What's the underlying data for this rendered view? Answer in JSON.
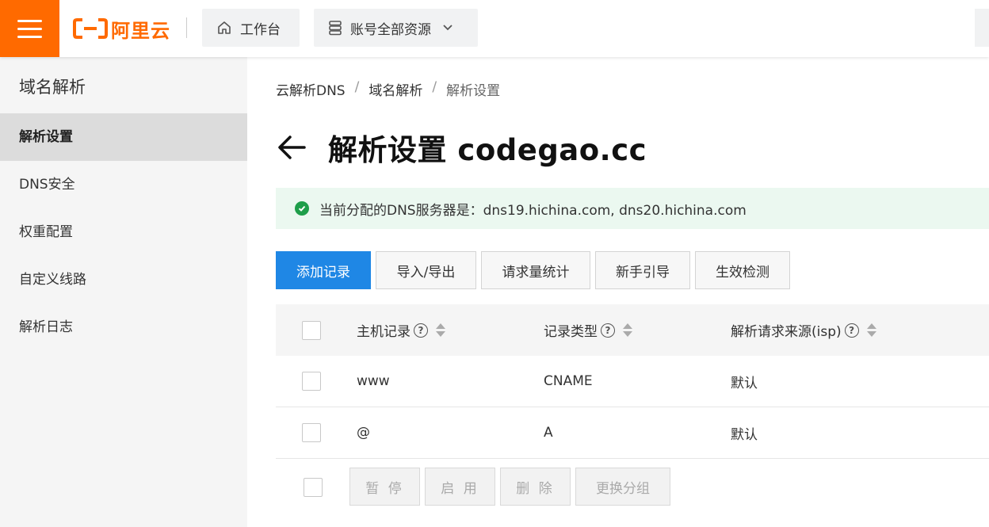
{
  "header": {
    "menu_icon": "hamburger-icon",
    "logo_text": "阿里云",
    "workbench_label": "工作台",
    "workbench_icon": "home-icon",
    "resources_label": "账号全部资源",
    "resources_icon": "database-icon",
    "brand_color": "#ff6a00"
  },
  "sidebar": {
    "title": "域名解析",
    "items": [
      {
        "label": "解析设置",
        "active": true
      },
      {
        "label": "DNS安全"
      },
      {
        "label": "权重配置"
      },
      {
        "label": "自定义线路"
      },
      {
        "label": "解析日志"
      }
    ]
  },
  "breadcrumb": [
    "云解析DNS",
    "域名解析",
    "解析设置"
  ],
  "page": {
    "title": "解析设置 codegao.cc",
    "alert": "当前分配的DNS服务器是：dns19.hichina.com, dns20.hichina.com"
  },
  "toolbar": {
    "add": "添加记录",
    "import_export": "导入/导出",
    "stats": "请求量统计",
    "guide": "新手引导",
    "check": "生效检测"
  },
  "table": {
    "headers": {
      "host": "主机记录",
      "type": "记录类型",
      "source": "解析请求来源(isp)"
    },
    "help_icon": "?",
    "rows": [
      {
        "host": "www",
        "type": "CNAME",
        "source": "默认"
      },
      {
        "host": "@",
        "type": "A",
        "source": "默认"
      }
    ]
  },
  "bulk_actions": {
    "pause": "暂 停",
    "enable": "启 用",
    "delete": "删 除",
    "change_group": "更换分组"
  }
}
